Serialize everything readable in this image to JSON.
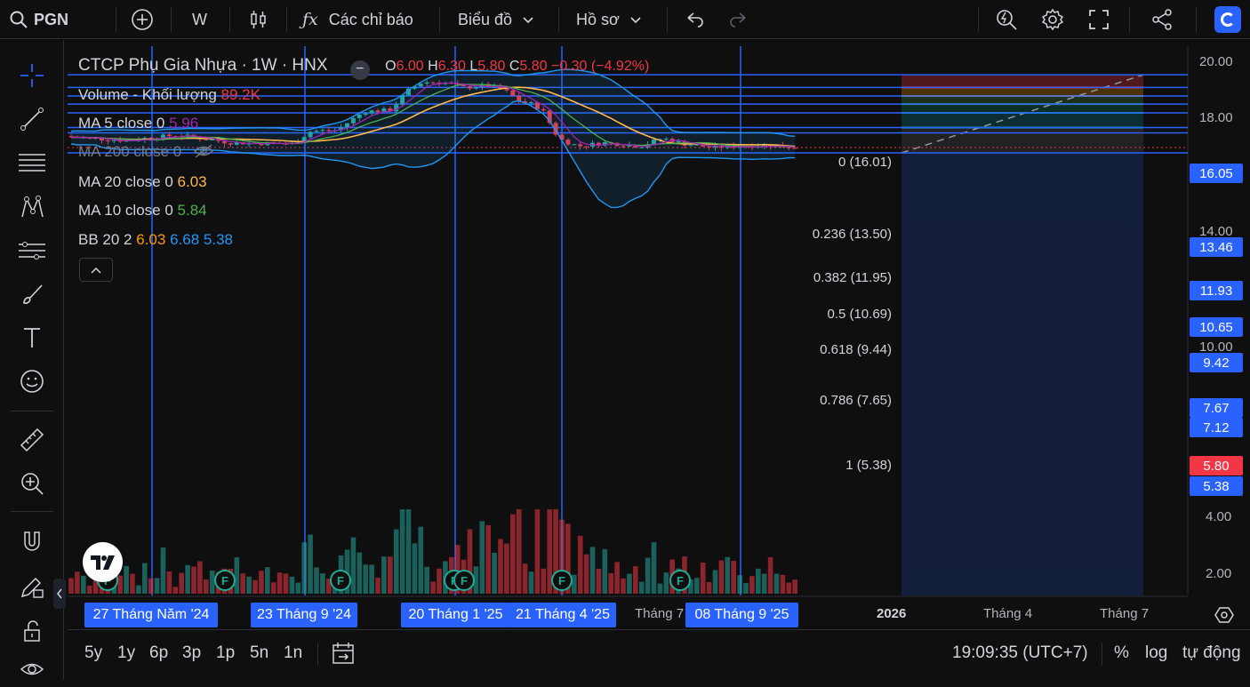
{
  "topbar": {
    "symbol": "PGN",
    "interval": "W",
    "indicators": "Các chỉ báo",
    "chart_menu": "Biểu đồ",
    "profile_menu": "Hồ sơ"
  },
  "legend": {
    "title": "CTCP Phụ Gia Nhựa · 1W · HNX",
    "o_label": "O",
    "o": "6.00",
    "h_label": "H",
    "h": "6.30",
    "l_label": "L",
    "l": "5.80",
    "c_label": "C",
    "c": "5.80",
    "chg": "−0.30 (−4.92%)",
    "volume_label": "Volume - Khối lượng",
    "volume": "89.2K",
    "ma5_label": "MA 5 close 0",
    "ma5": "5.96",
    "ma200_label": "MA 200 close 0",
    "ma20_label": "MA 20 close 0",
    "ma20": "6.03",
    "ma10_label": "MA 10 close 0",
    "ma10": "5.84",
    "bb_label": "BB 20 2",
    "bb_mid": "6.03",
    "bb_up": "6.68",
    "bb_low": "5.38"
  },
  "colors": {
    "up": "#26a69a",
    "down": "#f23645",
    "ma5": "#9c27b0",
    "ma20": "#ffb74d",
    "ma10": "#4caf50",
    "bb": "#2196f3",
    "hline": "#2962ff"
  },
  "price_axis": [
    "20.00",
    "18.00",
    "14.00",
    "10.00",
    "4.00",
    "2.00"
  ],
  "price_labels": [
    {
      "value": "16.05",
      "color": "#2962ff"
    },
    {
      "value": "13.46",
      "color": "#2962ff"
    },
    {
      "value": "11.93",
      "color": "#2962ff"
    },
    {
      "value": "10.65",
      "color": "#2962ff"
    },
    {
      "value": "9.42",
      "color": "#2962ff"
    },
    {
      "value": "7.67",
      "color": "#2962ff"
    },
    {
      "value": "7.12",
      "color": "#2962ff"
    },
    {
      "value": "5.80",
      "color": "#f23645"
    },
    {
      "value": "5.38",
      "color": "#2962ff"
    }
  ],
  "fib": [
    {
      "label": "0 (16.01)",
      "color": "#9598a1"
    },
    {
      "label": "0.236 (13.50)",
      "color": "#f23645"
    },
    {
      "label": "0.382 (11.95)",
      "color": "#ff9800"
    },
    {
      "label": "0.5 (10.69)",
      "color": "#4caf50"
    },
    {
      "label": "0.618 (9.44)",
      "color": "#089981"
    },
    {
      "label": "0.786 (7.65)",
      "color": "#00bcd4"
    },
    {
      "label": "1 (5.38)",
      "color": "#787b86"
    }
  ],
  "time_axis": {
    "selected": [
      "27 Tháng Năm '24",
      "23 Tháng 9 '24",
      "20 Tháng 1 '25",
      "21 Tháng 4 '25",
      "08 Tháng 9 '25"
    ],
    "plain": [
      "Tháng 7",
      "2026",
      "Tháng 4",
      "Tháng 7"
    ]
  },
  "bottom": {
    "ranges": [
      "5y",
      "1y",
      "6p",
      "3p",
      "1p",
      "5n",
      "1n"
    ],
    "time": "19:09:35 (UTC+7)",
    "percent": "%",
    "log": "log",
    "auto": "tự động"
  },
  "event_badge": "F"
}
